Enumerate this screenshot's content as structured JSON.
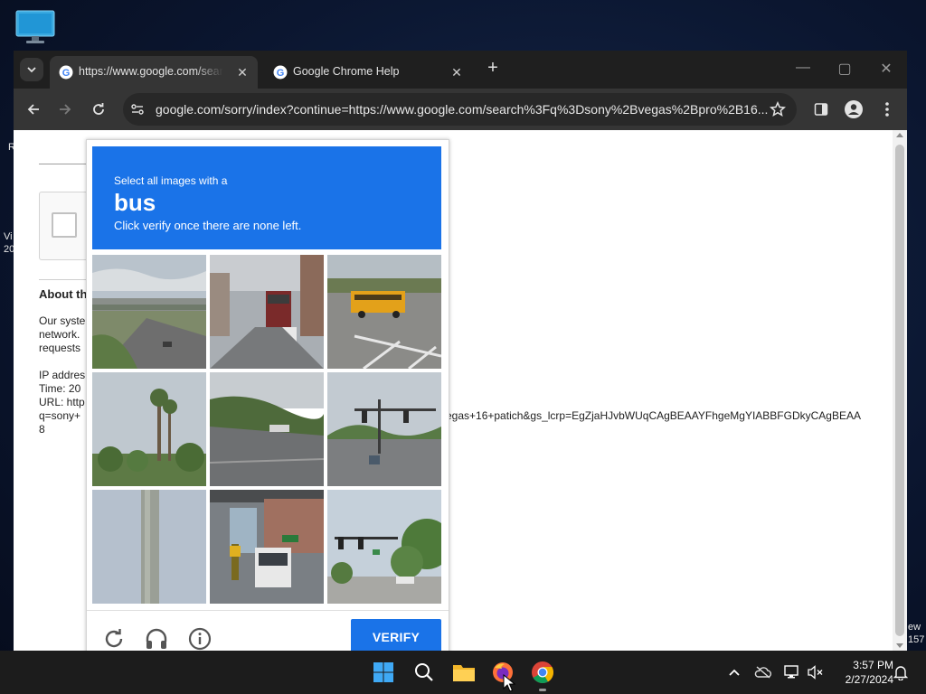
{
  "desktop": {
    "left_fragments": [
      "R",
      "Vi",
      "20"
    ],
    "right_fragments": [
      "ew",
      "157"
    ]
  },
  "browser": {
    "tabs": [
      {
        "label": "https://www.google.com/search",
        "active": true
      },
      {
        "label": "Google Chrome Help",
        "active": false
      }
    ],
    "address": "google.com/sorry/index?continue=https://www.google.com/search%3Fq%3Dsony%2Bvegas%2Bpro%2B16...",
    "window_controls": {
      "minimize": "—",
      "maximize": "▢",
      "close": "✕"
    }
  },
  "page": {
    "about_heading": "About th",
    "paragraph_lines": [
      "Our syste",
      "network.",
      "requests"
    ],
    "ip_line": "IP addres",
    "time_line": "Time: 20",
    "url_line": "URL: http",
    "q_line": "q=sony+",
    "eight_line": "8",
    "url_continuation": "egas+16+patich&gs_lcrp=EgZjaHJvbWUqCAgBEAAYFhgeMgYIABBFGDkyCAgBEAA"
  },
  "captcha": {
    "instruction_line1": "Select all images with a",
    "target": "bus",
    "instruction_line3": "Click verify once there are none left.",
    "verify_label": "VERIFY",
    "tiles": [
      "highway-overpass",
      "city-street-bus",
      "school-bus-parking",
      "palm-trees",
      "road-embankment",
      "intersection-traffic-lights",
      "pole-closeup",
      "city-bus-under-bridge",
      "street-traffic-lights"
    ]
  },
  "taskbar": {
    "time": "3:57 PM",
    "date": "2/27/2024",
    "apps": [
      "start",
      "search",
      "file-explorer",
      "firefox",
      "chrome"
    ]
  },
  "colors": {
    "captcha_blue": "#1a73e8",
    "chrome_dark": "#1f1f1f",
    "chrome_toolbar": "#353535"
  }
}
